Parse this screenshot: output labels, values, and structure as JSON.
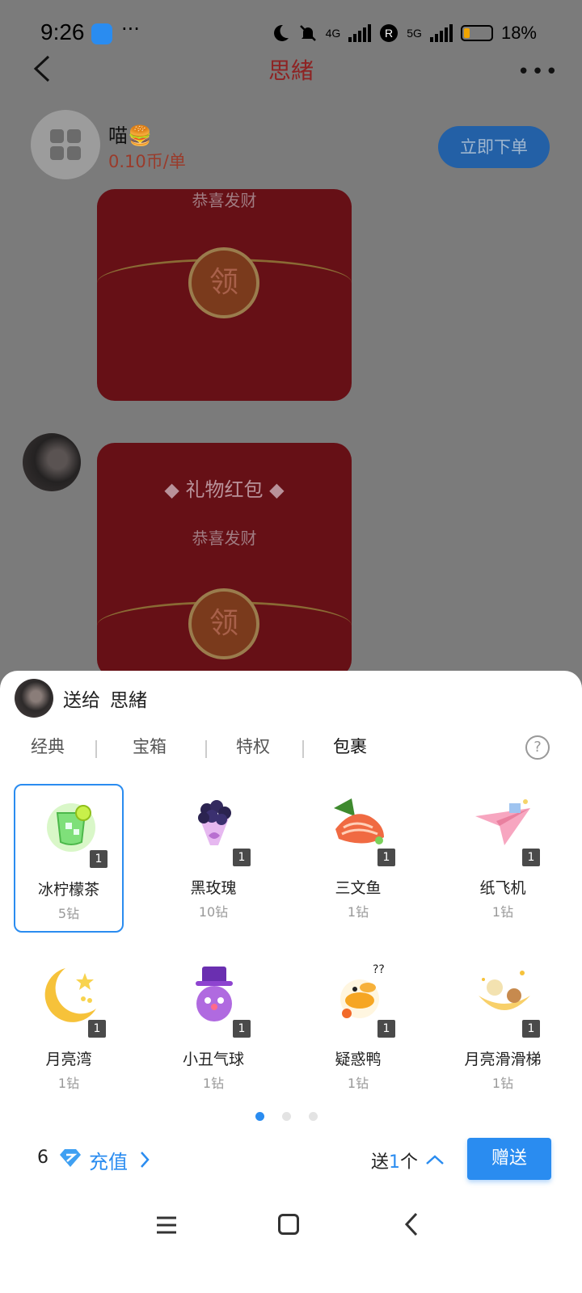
{
  "status_bar": {
    "time": "9:26",
    "more": "···",
    "net1": "4G",
    "roaming": "R",
    "net2": "5G",
    "battery_pct": "18%"
  },
  "header": {
    "title": "思緒",
    "more": "•••"
  },
  "seller": {
    "name": "喵🍔",
    "price": "0.10币/单",
    "order_button": "立即下单"
  },
  "chat": {
    "packet1_sub": "恭喜发财",
    "packet1_coin": "领",
    "packet2_title": "◆ 礼物红包 ◆",
    "packet2_sub": "恭喜发财",
    "packet2_coin": "领"
  },
  "gift_sheet": {
    "send_to_prefix": "送给",
    "recipient": "思緒",
    "tabs": [
      {
        "label": "经典"
      },
      {
        "label": "宝箱"
      },
      {
        "label": "特权"
      },
      {
        "label": "包裹",
        "active": true
      }
    ],
    "help": "?",
    "gifts": [
      {
        "name": "冰柠檬茶",
        "price": "5钻",
        "count": "1",
        "icon": "lemon-tea-icon",
        "selected": true
      },
      {
        "name": "黑玫瑰",
        "price": "10钻",
        "count": "1",
        "icon": "black-rose-icon"
      },
      {
        "name": "三文鱼",
        "price": "1钻",
        "count": "1",
        "icon": "salmon-icon"
      },
      {
        "name": "纸飞机",
        "price": "1钻",
        "count": "1",
        "icon": "paper-plane-icon"
      },
      {
        "name": "月亮湾",
        "price": "1钻",
        "count": "1",
        "icon": "moon-icon"
      },
      {
        "name": "小丑气球",
        "price": "1钻",
        "count": "1",
        "icon": "clown-balloon-icon"
      },
      {
        "name": "疑惑鸭",
        "price": "1钻",
        "count": "1",
        "icon": "confused-duck-icon"
      },
      {
        "name": "月亮滑滑梯",
        "price": "1钻",
        "count": "1",
        "icon": "moon-slide-icon"
      }
    ],
    "pages": 3,
    "current_page": 1,
    "balance": "6",
    "recharge_label": "充值",
    "send_qty_prefix": "送",
    "send_qty_num": "1",
    "send_qty_suffix": "个",
    "give_button": "赠送"
  },
  "colors": {
    "accent": "#2a8cf0",
    "overlay_bg": "#7b7b7b",
    "redpacket": "#661016"
  }
}
